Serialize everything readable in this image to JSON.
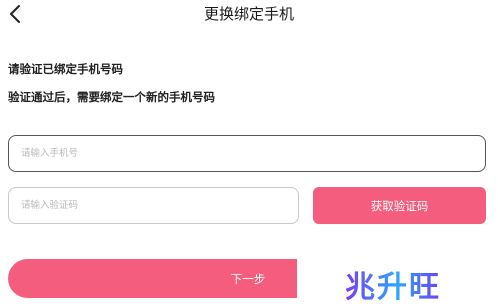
{
  "header": {
    "title": "更换绑定手机",
    "back_icon": "chevron-left-icon"
  },
  "hints": {
    "line1": "请验证已绑定手机号码",
    "line2": "验证通过后，需要绑定一个新的手机号码"
  },
  "phone": {
    "placeholder": "请输入手机号",
    "value": ""
  },
  "code": {
    "placeholder": "请输入验证码",
    "value": ""
  },
  "buttons": {
    "get_code": "获取验证码",
    "next": "下一步"
  },
  "watermark": {
    "text": "兆升旺"
  },
  "colors": {
    "accent": "#f55d7e",
    "text": "#222222",
    "placeholder": "#b9b9b9"
  }
}
